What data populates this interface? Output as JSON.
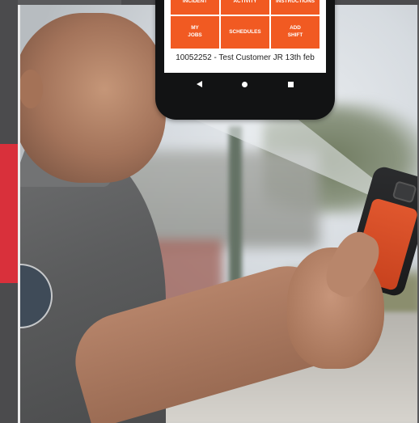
{
  "phone": {
    "tiles_top": [
      "INCIDENT",
      "ACTIVITY",
      "INSTRUCTIONS"
    ],
    "tiles_mid": [
      "MY\nJOBS",
      "SCHEDULES",
      "ADD\nSHIFT"
    ],
    "job_line": "10052252 - Test Customer JR 13th feb",
    "nav": [
      "back-icon",
      "home-icon",
      "recents-icon"
    ]
  },
  "colors": {
    "accent_red": "#d9303b",
    "tile_orange": "#f15a22",
    "device_orange": "#e0572e"
  }
}
